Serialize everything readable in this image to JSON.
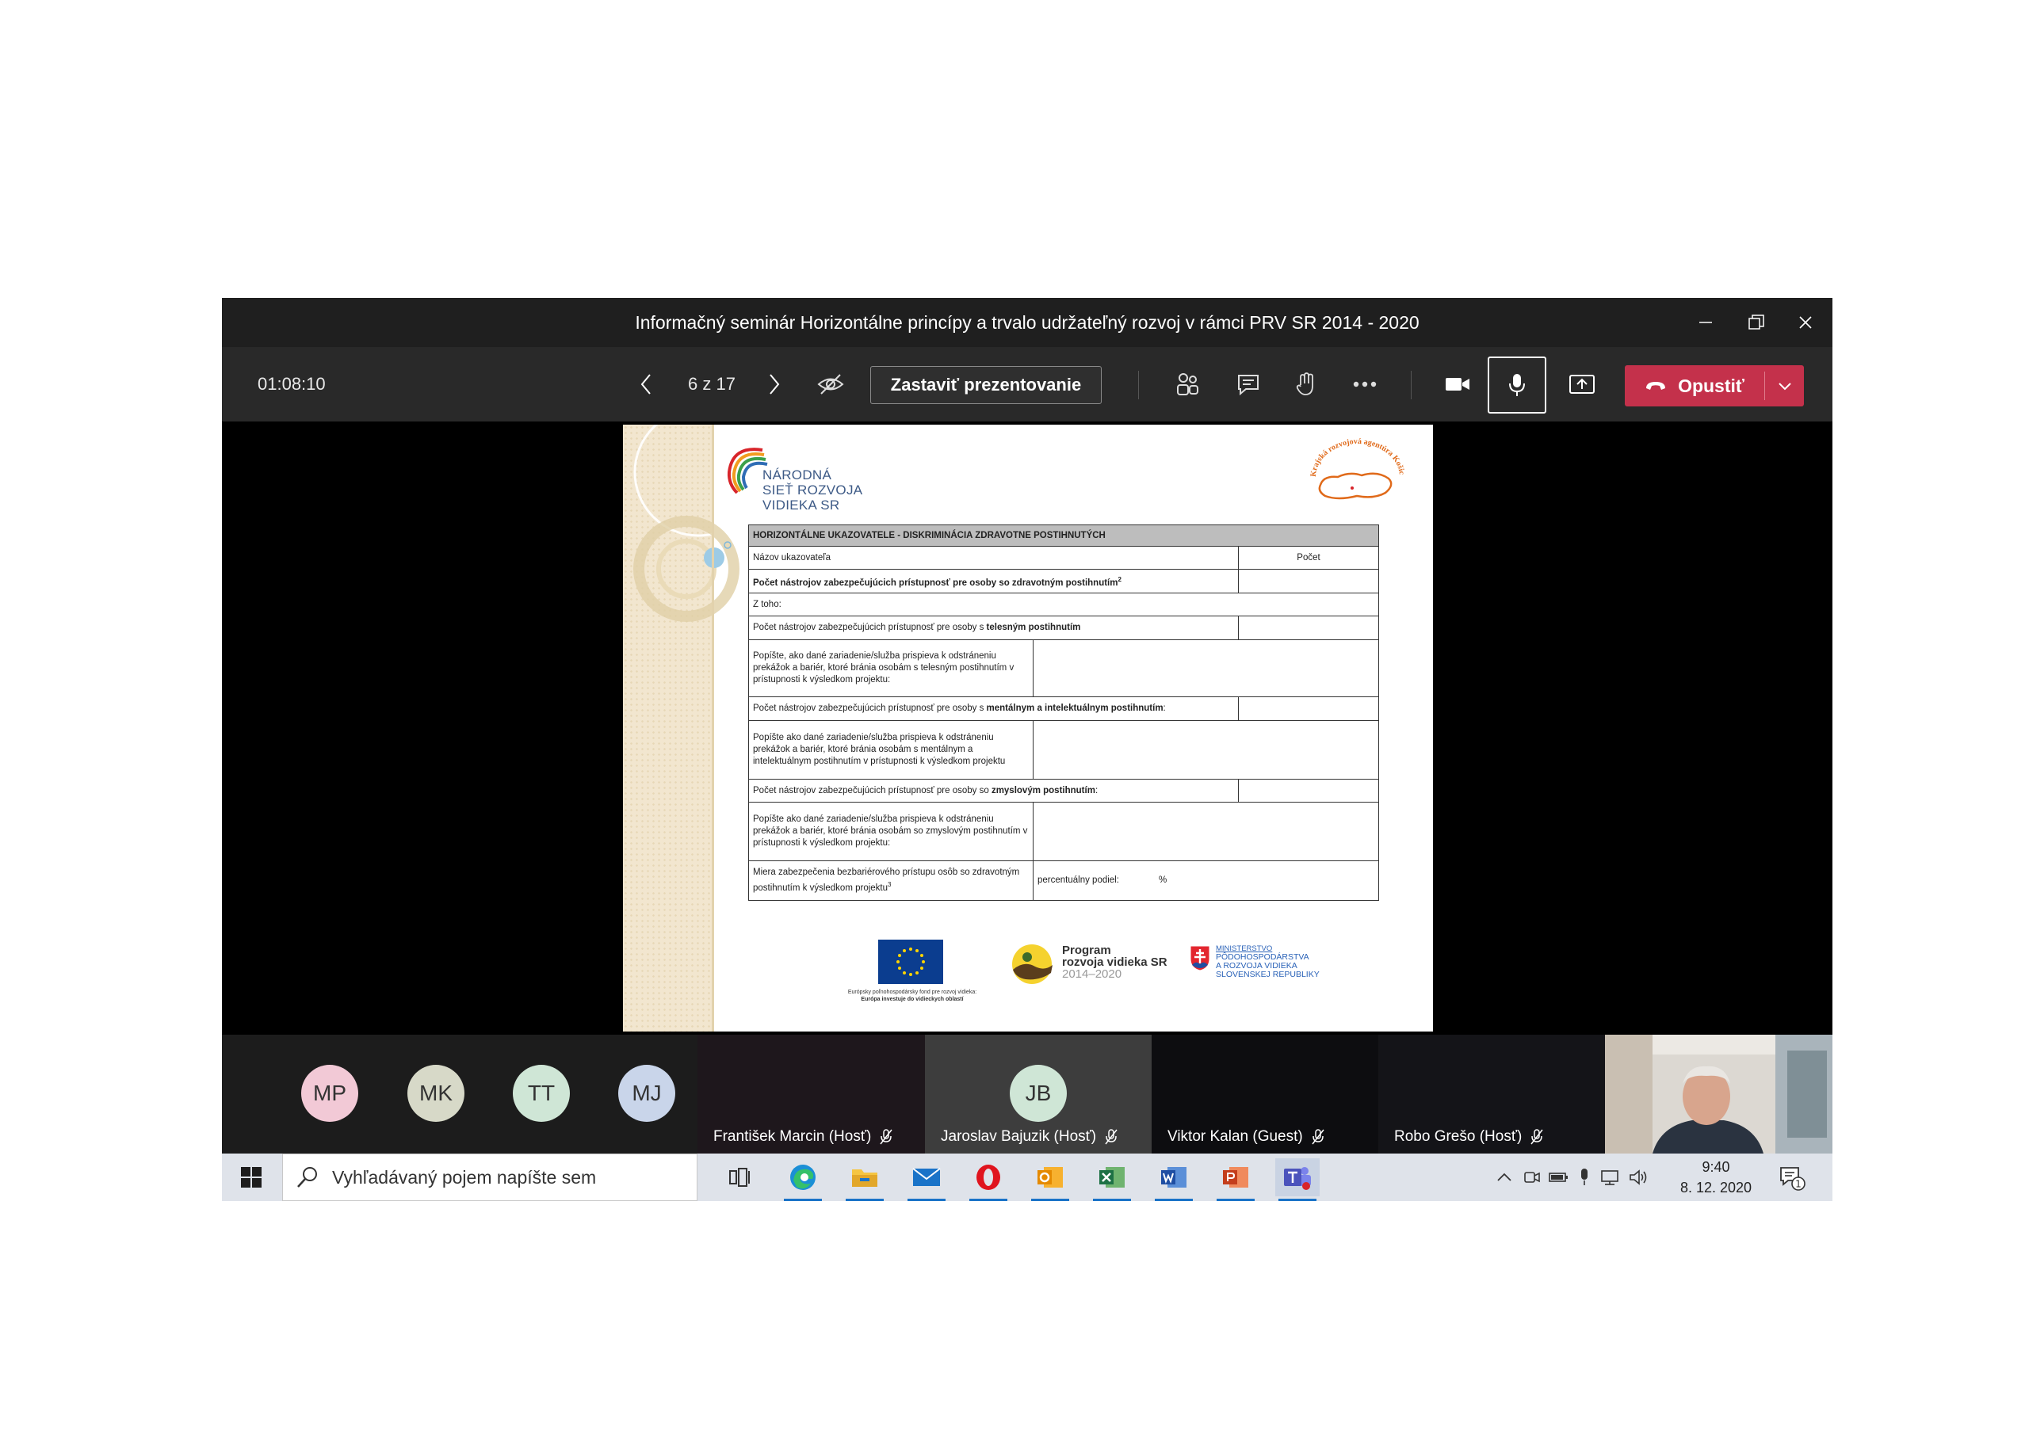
{
  "window": {
    "title": "Informačný seminár Horizontálne princípy a trvalo udržateľný rozvoj v rámci PRV SR 2014 - 2020"
  },
  "toolbar": {
    "timer": "01:08:10",
    "page_indicator": "6 z 17",
    "stop_presenting_label": "Zastaviť prezentovanie",
    "leave_label": "Opustiť",
    "colors": {
      "leave": "#c4314b",
      "toolbar_bg": "#292929"
    }
  },
  "slide": {
    "org_logo_text": [
      "NÁRODNÁ",
      "SIEŤ ROZVOJA",
      "VIDIEKA SR"
    ],
    "region_logo_text": "Krajská rozvojová agentúra Košického kraja",
    "table": {
      "header": "HORIZONTÁLNE UKAZOVATELE - DISKRIMINÁCIA ZDRAVOTNE POSTIHNUTÝCH",
      "col_name": "Názov ukazovateľa",
      "col_count": "Počet",
      "row_total": "Počet nástrojov zabezpečujúcich prístupnosť pre osoby so zdravotným postihnutím",
      "row_total_sup": "2",
      "z_toho": "Z toho:",
      "row_physical_pre": "Počet nástrojov zabezpečujúcich prístupnosť pre osoby s ",
      "row_physical_bold": "telesným postihnutím",
      "desc_physical": "Popíšte, ako dané zariadenie/služba prispieva k odstráneniu prekážok a bariér, ktoré bránia osobám s telesným postihnutím v prístupnosti k výsledkom projektu:",
      "row_mental_pre": "Počet nástrojov zabezpečujúcich prístupnosť pre osoby s ",
      "row_mental_bold": "mentálnym a intelektuálnym postihnutím",
      "row_mental_post": ":",
      "desc_mental": "Popíšte ako dané zariadenie/služba prispieva k odstráneniu prekážok a bariér, ktoré bránia osobám s mentálnym a intelektuálnym postihnutím v prístupnosti k výsledkom projektu",
      "row_sensory_pre": "Počet nástrojov zabezpečujúcich prístupnosť pre osoby so ",
      "row_sensory_bold": "zmyslovým postihnutím",
      "row_sensory_post": ":",
      "desc_sensory": "Popíšte ako dané zariadenie/služba prispieva k odstráneniu prekážok a bariér, ktoré bránia osobám so zmyslovým postihnutím v prístupnosti k výsledkom projektu:",
      "row_barrierfree": "Miera zabezpečenia bezbariérového prístupu osôb so zdravotným postihnutím k výsledkom projektu",
      "row_barrierfree_sup": "3",
      "share_label": "percentuálny podiel:",
      "share_unit": "%"
    },
    "footer": {
      "eu_caption_1": "Európsky poľnohospodársky fond pre rozvoj vidieka:",
      "eu_caption_2": "Európa investuje do vidieckych oblastí",
      "prv_1": "Program",
      "prv_2": "rozvoja vidieka SR",
      "prv_3": "2014–2020",
      "ministry": [
        "MINISTERSTVO",
        "PÔDOHOSPODÁRSTVA",
        "A ROZVOJA VIDIEKA",
        "SLOVENSKEJ REPUBLIKY"
      ]
    }
  },
  "participants": {
    "avatars": [
      {
        "initials": "MP",
        "color": "#f2c9d6"
      },
      {
        "initials": "MK",
        "color": "#d7d9c8"
      },
      {
        "initials": "TT",
        "color": "#cfe6d6"
      },
      {
        "initials": "MJ",
        "color": "#c9d5ea"
      }
    ],
    "tiles": [
      {
        "name": "František Marcin (Hosť)"
      },
      {
        "name": "Jaroslav Bajuzik (Hosť)",
        "initials": "JB",
        "color": "#cfe6d6"
      },
      {
        "name": "Viktor Kalan (Guest)"
      },
      {
        "name": "Robo Grešo (Hosť)"
      }
    ]
  },
  "taskbar": {
    "search_placeholder": "Vyhľadávaný pojem napíšte sem",
    "time": "9:40",
    "date": "8. 12. 2020",
    "notification_count": "1",
    "apps": [
      "task-view",
      "edge",
      "file-explorer",
      "mail",
      "opera",
      "outlook",
      "excel",
      "word",
      "powerpoint",
      "teams"
    ]
  }
}
